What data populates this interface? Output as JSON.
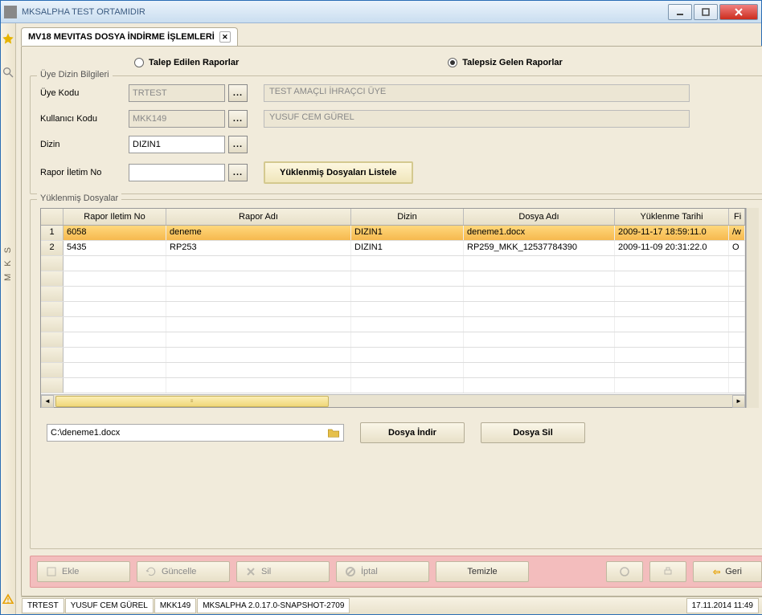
{
  "window": {
    "title": "MKSALPHA TEST ORTAMIDIR"
  },
  "sidebar": {
    "mks_label": "M K S"
  },
  "tab": {
    "title": "MV18 MEVITAS DOSYA İNDİRME İŞLEMLERİ"
  },
  "radios": {
    "option1": "Talep Edilen Raporlar",
    "option2": "Talepsiz Gelen Raporlar",
    "selected": 2
  },
  "dizin_section": {
    "legend": "Üye Dizin Bilgileri",
    "uye_kodu_label": "Üye Kodu",
    "uye_kodu_value": "TRTEST",
    "uye_kodu_desc": "TEST AMAÇLI İHRAÇCI ÜYE",
    "kullanici_label": "Kullanıcı Kodu",
    "kullanici_value": "MKK149",
    "kullanici_desc": "YUSUF CEM GÜREL",
    "dizin_label": "Dizin",
    "dizin_value": "DIZIN1",
    "rapor_label": "Rapor İletim No",
    "rapor_value": "",
    "list_button": "Yüklenmiş Dosyaları Listele"
  },
  "files_section": {
    "legend": "Yüklenmiş Dosyalar",
    "columns": {
      "c1": "Rapor Iletim No",
      "c2": "Rapor Adı",
      "c3": "Dizin",
      "c4": "Dosya Adı",
      "c5": "Yüklenme Tarihi",
      "c6": "Fi"
    },
    "rows": [
      {
        "no": "1",
        "c1": "6058",
        "c2": "deneme",
        "c3": "DIZIN1",
        "c4": "deneme1.docx",
        "c5": "2009-11-17 18:59:11.0",
        "c6": "/w",
        "selected": true
      },
      {
        "no": "2",
        "c1": "5435",
        "c2": "RP253",
        "c3": "DIZIN1",
        "c4": "RP259_MKK_12537784390",
        "c5": "2009-11-09 20:31:22.0",
        "c6": "O",
        "selected": false
      }
    ]
  },
  "file_actions": {
    "path": "C:\\deneme1.docx",
    "download": "Dosya İndir",
    "delete": "Dosya Sil"
  },
  "bottom": {
    "ekle": "Ekle",
    "guncelle": "Güncelle",
    "sil": "Sil",
    "iptal": "İptal",
    "temizle": "Temizle",
    "geri": "Geri"
  },
  "status": {
    "s1": "TRTEST",
    "s2": "YUSUF CEM GÜREL",
    "s3": "MKK149",
    "s4": "MKSALPHA 2.0.17.0-SNAPSHOT-2709",
    "datetime": "17.11.2014 11:49"
  }
}
